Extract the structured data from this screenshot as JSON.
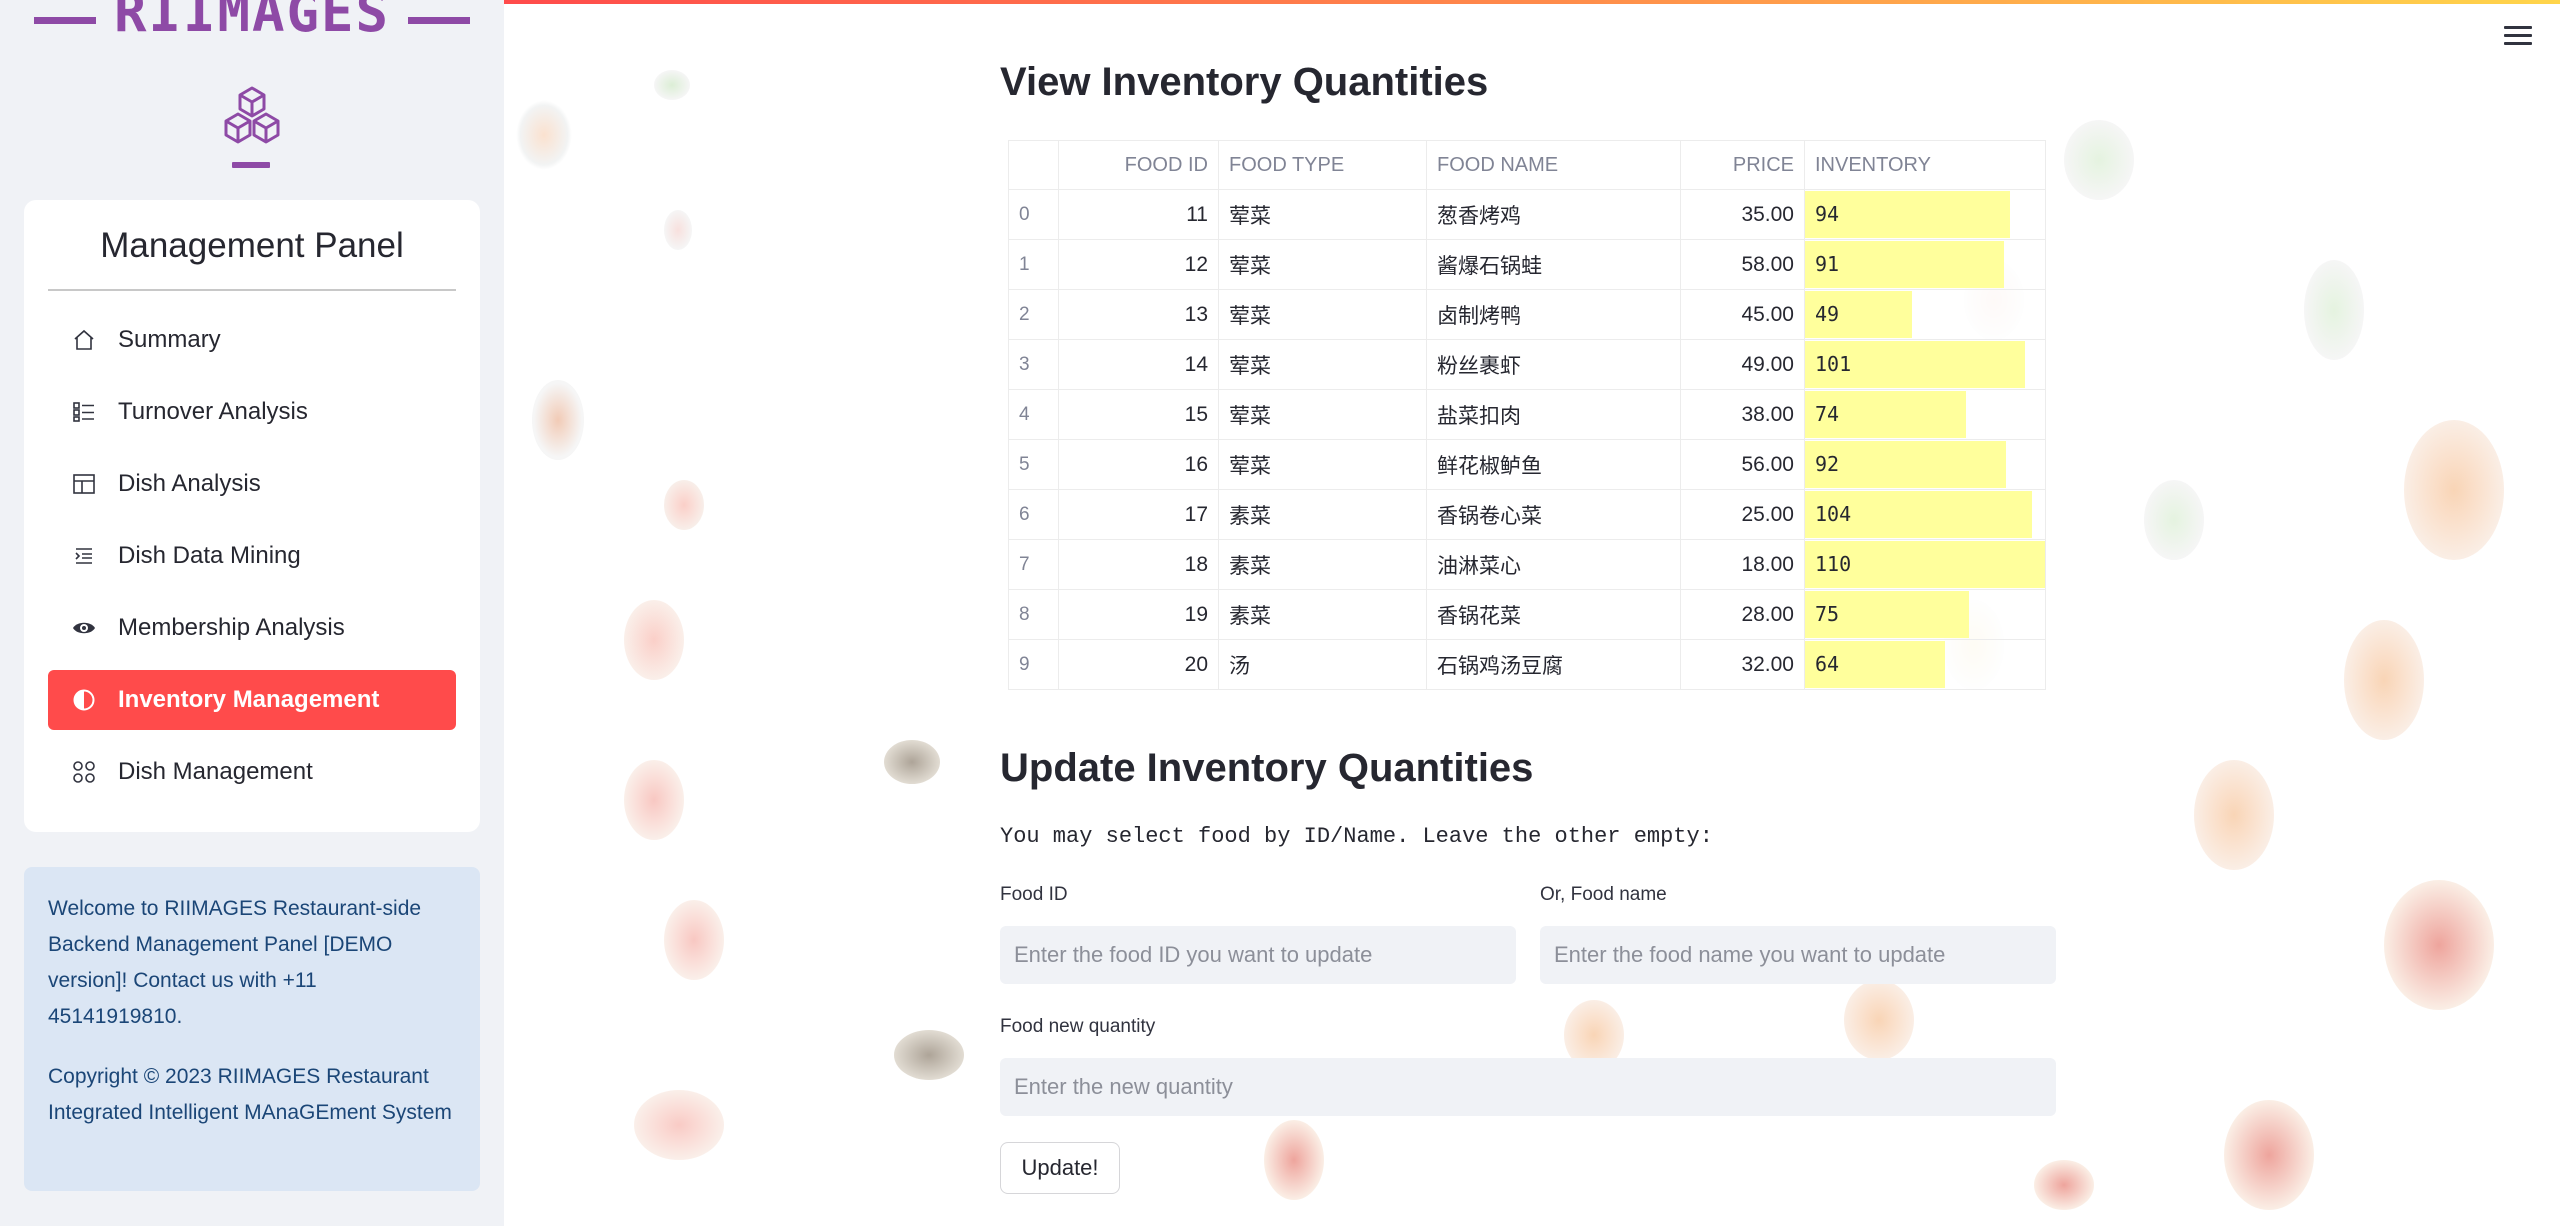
{
  "sidebar": {
    "brand": "RIIMAGES",
    "panel_title": "Management Panel",
    "items": [
      {
        "label": "Summary",
        "icon": "house-icon"
      },
      {
        "label": "Turnover Analysis",
        "icon": "list-task-icon"
      },
      {
        "label": "Dish Analysis",
        "icon": "layout-icon"
      },
      {
        "label": "Dish Data Mining",
        "icon": "text-indent-icon"
      },
      {
        "label": "Membership Analysis",
        "icon": "eye-icon"
      },
      {
        "label": "Inventory Management",
        "icon": "circle-half-icon",
        "active": true
      },
      {
        "label": "Dish Management",
        "icon": "grid-circles-icon"
      }
    ],
    "info": {
      "welcome": "Welcome to RIIMAGES Restaurant-side Backend Management Panel [DEMO version]! Contact us with +11 45141919810.",
      "copyright": "Copyright © 2023 RIIMAGES Restaurant Integrated Intelligent MAnaGEment System"
    },
    "colors": {
      "brand": "#8e4aa6",
      "active": "#ff4b4b",
      "info_bg": "#dbe6f4"
    }
  },
  "main": {
    "view_title": "View Inventory Quantities",
    "table": {
      "headers": [
        "",
        "FOOD ID",
        "FOOD TYPE",
        "FOOD NAME",
        "PRICE",
        "INVENTORY"
      ],
      "rows": [
        {
          "idx": "0",
          "id": "11",
          "type": "荤菜",
          "name": "葱香烤鸡",
          "price": "35.00",
          "inventory": 94
        },
        {
          "idx": "1",
          "id": "12",
          "type": "荤菜",
          "name": "酱爆石锅蛙",
          "price": "58.00",
          "inventory": 91
        },
        {
          "idx": "2",
          "id": "13",
          "type": "荤菜",
          "name": "卤制烤鸭",
          "price": "45.00",
          "inventory": 49
        },
        {
          "idx": "3",
          "id": "14",
          "type": "荤菜",
          "name": "粉丝裹虾",
          "price": "49.00",
          "inventory": 101
        },
        {
          "idx": "4",
          "id": "15",
          "type": "荤菜",
          "name": "盐菜扣肉",
          "price": "38.00",
          "inventory": 74
        },
        {
          "idx": "5",
          "id": "16",
          "type": "荤菜",
          "name": "鲜花椒鲈鱼",
          "price": "56.00",
          "inventory": 92
        },
        {
          "idx": "6",
          "id": "17",
          "type": "素菜",
          "name": "香锅卷心菜",
          "price": "25.00",
          "inventory": 104
        },
        {
          "idx": "7",
          "id": "18",
          "type": "素菜",
          "name": "油淋菜心",
          "price": "18.00",
          "inventory": 110
        },
        {
          "idx": "8",
          "id": "19",
          "type": "素菜",
          "name": "香锅花菜",
          "price": "28.00",
          "inventory": 75
        },
        {
          "idx": "9",
          "id": "20",
          "type": "汤",
          "name": "石锅鸡汤豆腐",
          "price": "32.00",
          "inventory": 64
        }
      ],
      "bar_color": "#ffff9c"
    },
    "update_title": "Update Inventory Quantities",
    "hint": "You may select food by ID/Name. Leave the other empty:",
    "food_id_label": "Food ID",
    "food_id_placeholder": "Enter the food ID you want to update",
    "food_name_label": "Or, Food name",
    "food_name_placeholder": "Enter the food name you want to update",
    "quantity_label": "Food new quantity",
    "quantity_placeholder": "Enter the new quantity",
    "update_button": "Update!"
  }
}
